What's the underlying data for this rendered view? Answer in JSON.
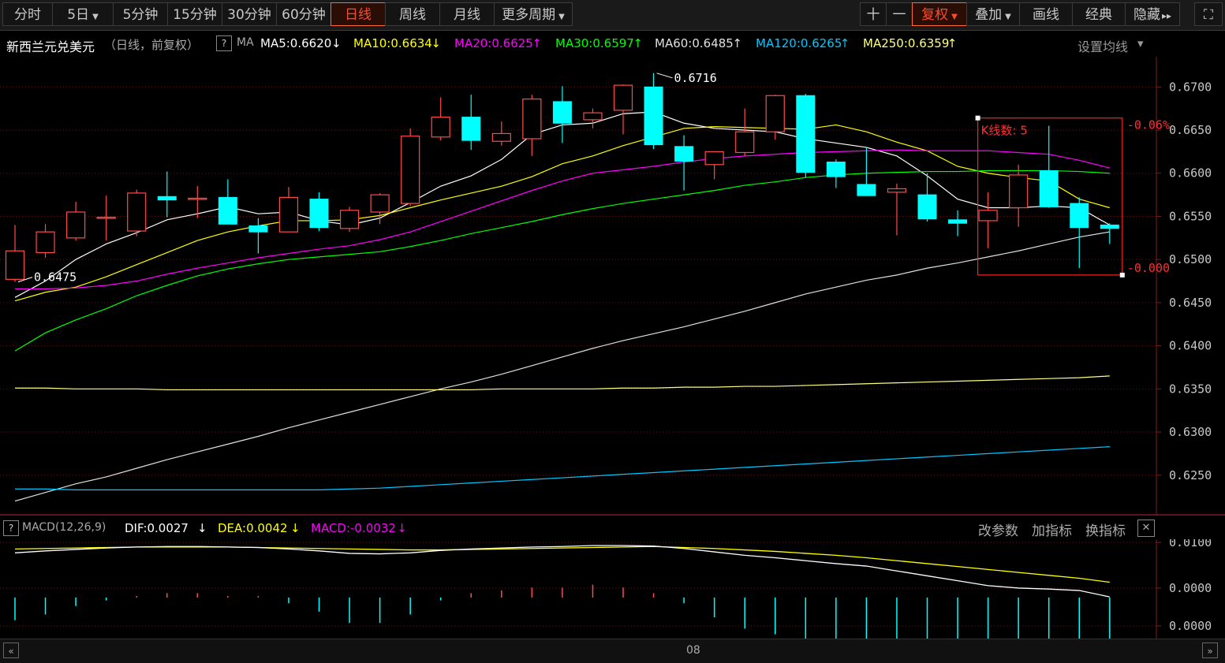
{
  "toolbar": {
    "periods": [
      {
        "label": "分时",
        "dropdown": false,
        "active": false
      },
      {
        "label": "5日",
        "dropdown": true,
        "active": false
      },
      {
        "label": "5分钟",
        "dropdown": false,
        "active": false
      },
      {
        "label": "15分钟",
        "dropdown": false,
        "active": false
      },
      {
        "label": "30分钟",
        "dropdown": false,
        "active": false
      },
      {
        "label": "60分钟",
        "dropdown": false,
        "active": false
      },
      {
        "label": "日线",
        "dropdown": false,
        "active": true
      },
      {
        "label": "周线",
        "dropdown": false,
        "active": false
      },
      {
        "label": "月线",
        "dropdown": false,
        "active": false
      },
      {
        "label": "更多周期",
        "dropdown": true,
        "active": false
      }
    ],
    "right_buttons": [
      {
        "label": "十",
        "dropdown": false,
        "active": false
      },
      {
        "label": "一",
        "dropdown": false,
        "active": false
      },
      {
        "label": "复权",
        "dropdown": true,
        "active": true
      },
      {
        "label": "叠加",
        "dropdown": true,
        "active": false
      },
      {
        "label": "画线",
        "dropdown": false,
        "active": false
      },
      {
        "label": "经典",
        "dropdown": false,
        "active": false
      },
      {
        "label": "隐藏",
        "dropdown": false,
        "active": false
      }
    ],
    "hide_arrow": "▸▸",
    "fullscreen_glyph": "⛶"
  },
  "legend": {
    "title": "新西兰元兑美元",
    "subtitle": "（日线，前复权）",
    "help": "?",
    "ma_label": "MA",
    "items": [
      {
        "text": "MA5:0.6620",
        "arrow": "↓",
        "color": "#ffffff"
      },
      {
        "text": "MA10:0.6634",
        "arrow": "↓",
        "color": "#ffff00"
      },
      {
        "text": "MA20:0.6625",
        "arrow": "↑",
        "color": "#ff00ff"
      },
      {
        "text": "MA30:0.6597",
        "arrow": "↑",
        "color": "#00ff00"
      },
      {
        "text": "MA60:0.6485",
        "arrow": "↑",
        "color": "#e0e0e0"
      },
      {
        "text": "MA120:0.6265",
        "arrow": "↑",
        "color": "#00c8ff"
      },
      {
        "text": "MA250:0.6359",
        "arrow": "↑",
        "color": "#ffff80"
      }
    ],
    "settings": "设置均线",
    "settings_caret": "▾"
  },
  "macd_header": {
    "help": "?",
    "name": "MACD(12,26,9)",
    "items": [
      {
        "text": "DIF:0.0027",
        "arrow": "↓",
        "color": "#ffffff"
      },
      {
        "text": "DEA:0.0042",
        "arrow": "↓",
        "color": "#ffff00"
      },
      {
        "text": "MACD:-0.0032",
        "arrow": "↓",
        "color": "#ff00ff"
      }
    ],
    "actions": [
      "改参数",
      "加指标",
      "换指标"
    ],
    "close": "✕"
  },
  "annotations": {
    "high_label": "0.6716",
    "low_label": "0.6475",
    "box_count": "K线数: 5",
    "box_top_pct": "-0.06%",
    "box_bottom_pct": "-0.000"
  },
  "x_axis_label": "08",
  "nav": {
    "left": "«",
    "right": "»"
  },
  "colors": {
    "up": "#ff4a4a",
    "down": "#00ffff",
    "grid": "#5a1a1a",
    "axis_text": "#c8c8c8",
    "ma5": "#ffffff",
    "ma10": "#ffff00",
    "ma20": "#ff00ff",
    "ma30": "#00ff00",
    "ma60": "#e0e0e0",
    "ma120": "#00c8ff",
    "ma250": "#ffff80"
  },
  "chart_data": [
    {
      "type": "candlestick",
      "ylim": [
        0.6205,
        0.6735
      ],
      "yticks": [
        0.625,
        0.63,
        0.635,
        0.64,
        0.645,
        0.65,
        0.655,
        0.66,
        0.665,
        0.67
      ],
      "candles": [
        {
          "o": 0.6477,
          "h": 0.654,
          "l": 0.6474,
          "c": 0.651
        },
        {
          "o": 0.6508,
          "h": 0.6541,
          "l": 0.6502,
          "c": 0.6532
        },
        {
          "o": 0.6525,
          "h": 0.6567,
          "l": 0.6522,
          "c": 0.6555
        },
        {
          "o": 0.6549,
          "h": 0.6574,
          "l": 0.6522,
          "c": 0.6549
        },
        {
          "o": 0.6533,
          "h": 0.6581,
          "l": 0.6527,
          "c": 0.6577
        },
        {
          "o": 0.6573,
          "h": 0.6602,
          "l": 0.6549,
          "c": 0.6569
        },
        {
          "o": 0.6571,
          "h": 0.6585,
          "l": 0.6548,
          "c": 0.6571
        },
        {
          "o": 0.6572,
          "h": 0.6593,
          "l": 0.6542,
          "c": 0.6541
        },
        {
          "o": 0.6539,
          "h": 0.6548,
          "l": 0.6507,
          "c": 0.6532
        },
        {
          "o": 0.6532,
          "h": 0.6584,
          "l": 0.6532,
          "c": 0.6572
        },
        {
          "o": 0.657,
          "h": 0.6578,
          "l": 0.6533,
          "c": 0.6537
        },
        {
          "o": 0.6536,
          "h": 0.6561,
          "l": 0.6532,
          "c": 0.6557
        },
        {
          "o": 0.6555,
          "h": 0.6577,
          "l": 0.6541,
          "c": 0.6575
        },
        {
          "o": 0.6565,
          "h": 0.6652,
          "l": 0.6562,
          "c": 0.6643
        },
        {
          "o": 0.6642,
          "h": 0.6688,
          "l": 0.6638,
          "c": 0.6665
        },
        {
          "o": 0.6665,
          "h": 0.6691,
          "l": 0.6627,
          "c": 0.6638
        },
        {
          "o": 0.6637,
          "h": 0.666,
          "l": 0.6632,
          "c": 0.6646
        },
        {
          "o": 0.664,
          "h": 0.6691,
          "l": 0.662,
          "c": 0.6686
        },
        {
          "o": 0.6683,
          "h": 0.6701,
          "l": 0.6635,
          "c": 0.6658
        },
        {
          "o": 0.6662,
          "h": 0.6675,
          "l": 0.6652,
          "c": 0.667
        },
        {
          "o": 0.6673,
          "h": 0.6703,
          "l": 0.6645,
          "c": 0.6702
        },
        {
          "o": 0.67,
          "h": 0.6716,
          "l": 0.6628,
          "c": 0.6633
        },
        {
          "o": 0.6631,
          "h": 0.6644,
          "l": 0.658,
          "c": 0.6614
        },
        {
          "o": 0.661,
          "h": 0.6625,
          "l": 0.6593,
          "c": 0.6625
        },
        {
          "o": 0.6624,
          "h": 0.6675,
          "l": 0.662,
          "c": 0.6648
        },
        {
          "o": 0.6648,
          "h": 0.6691,
          "l": 0.6639,
          "c": 0.669
        },
        {
          "o": 0.669,
          "h": 0.6692,
          "l": 0.6595,
          "c": 0.6601
        },
        {
          "o": 0.6613,
          "h": 0.6616,
          "l": 0.6583,
          "c": 0.6596
        },
        {
          "o": 0.6587,
          "h": 0.663,
          "l": 0.6575,
          "c": 0.6574
        },
        {
          "o": 0.6578,
          "h": 0.6588,
          "l": 0.6528,
          "c": 0.6582
        },
        {
          "o": 0.6575,
          "h": 0.66,
          "l": 0.6544,
          "c": 0.6547
        },
        {
          "o": 0.6546,
          "h": 0.6557,
          "l": 0.6527,
          "c": 0.6542
        },
        {
          "o": 0.6545,
          "h": 0.6578,
          "l": 0.6513,
          "c": 0.6557
        },
        {
          "o": 0.656,
          "h": 0.661,
          "l": 0.6538,
          "c": 0.6598
        },
        {
          "o": 0.6603,
          "h": 0.6655,
          "l": 0.656,
          "c": 0.6561
        },
        {
          "o": 0.6565,
          "h": 0.6572,
          "l": 0.649,
          "c": 0.6537
        },
        {
          "o": 0.654,
          "h": 0.6542,
          "l": 0.6518,
          "c": 0.6536
        }
      ],
      "ma": [
        {
          "name": "MA5",
          "color": "#ffffff",
          "values": [
            0.6456,
            0.6475,
            0.65,
            0.6518,
            0.6531,
            0.6546,
            0.6553,
            0.6561,
            0.6553,
            0.6555,
            0.6545,
            0.654,
            0.6548,
            0.6566,
            0.6585,
            0.6597,
            0.6616,
            0.6645,
            0.6656,
            0.6658,
            0.6669,
            0.6671,
            0.6658,
            0.6652,
            0.665,
            0.6648,
            0.664,
            0.6635,
            0.663,
            0.662,
            0.6597,
            0.657,
            0.656,
            0.656,
            0.6562,
            0.656,
            0.654
          ]
        },
        {
          "name": "MA10",
          "color": "#ffff00",
          "values": [
            0.6452,
            0.6462,
            0.6468,
            0.648,
            0.6494,
            0.6508,
            0.6522,
            0.6532,
            0.6539,
            0.6545,
            0.6545,
            0.6546,
            0.6551,
            0.656,
            0.6569,
            0.6577,
            0.6585,
            0.6596,
            0.6611,
            0.662,
            0.6632,
            0.6642,
            0.6652,
            0.6654,
            0.6653,
            0.6652,
            0.6651,
            0.6656,
            0.6648,
            0.6636,
            0.6626,
            0.6608,
            0.66,
            0.6595,
            0.6591,
            0.657,
            0.656
          ]
        },
        {
          "name": "MA20",
          "color": "#ff00ff",
          "values": [
            0.6466,
            0.6466,
            0.6467,
            0.647,
            0.6475,
            0.6483,
            0.649,
            0.6496,
            0.6502,
            0.6507,
            0.6512,
            0.6516,
            0.6523,
            0.6532,
            0.6544,
            0.6556,
            0.6568,
            0.658,
            0.6591,
            0.66,
            0.6604,
            0.6608,
            0.6613,
            0.6617,
            0.662,
            0.6622,
            0.6624,
            0.6625,
            0.6626,
            0.6627,
            0.6626,
            0.6626,
            0.6626,
            0.6624,
            0.6622,
            0.6615,
            0.6606
          ]
        },
        {
          "name": "MA30",
          "color": "#00ff00",
          "values": [
            0.6394,
            0.6415,
            0.643,
            0.6443,
            0.6458,
            0.647,
            0.6481,
            0.6489,
            0.6495,
            0.65,
            0.6503,
            0.6506,
            0.6509,
            0.6515,
            0.6522,
            0.653,
            0.6537,
            0.6544,
            0.6552,
            0.6559,
            0.6565,
            0.657,
            0.6575,
            0.658,
            0.6586,
            0.659,
            0.6595,
            0.6598,
            0.66,
            0.6601,
            0.6602,
            0.6602,
            0.6603,
            0.6603,
            0.6603,
            0.6602,
            0.66
          ]
        },
        {
          "name": "MA60",
          "color": "#e0e0e0",
          "values": [
            0.622,
            0.623,
            0.624,
            0.6248,
            0.6258,
            0.6268,
            0.6277,
            0.6286,
            0.6295,
            0.6305,
            0.6314,
            0.6323,
            0.6332,
            0.6341,
            0.635,
            0.6358,
            0.6367,
            0.6377,
            0.6387,
            0.6397,
            0.6406,
            0.6414,
            0.6422,
            0.6431,
            0.644,
            0.645,
            0.646,
            0.6468,
            0.6476,
            0.6482,
            0.649,
            0.6496,
            0.6503,
            0.651,
            0.6518,
            0.6526,
            0.6532
          ]
        },
        {
          "name": "MA120",
          "color": "#00c8ff",
          "values": [
            0.6234,
            0.6234,
            0.6233,
            0.6233,
            0.6233,
            0.6233,
            0.6233,
            0.6233,
            0.6233,
            0.6233,
            0.6233,
            0.6234,
            0.6235,
            0.6237,
            0.6239,
            0.6241,
            0.6243,
            0.6245,
            0.6247,
            0.6249,
            0.6251,
            0.6253,
            0.6255,
            0.6257,
            0.6259,
            0.6261,
            0.6263,
            0.6265,
            0.6267,
            0.6269,
            0.6271,
            0.6273,
            0.6275,
            0.6277,
            0.6279,
            0.6281,
            0.6283
          ]
        },
        {
          "name": "MA250",
          "color": "#ffff80",
          "values": [
            0.6351,
            0.6351,
            0.635,
            0.635,
            0.635,
            0.6349,
            0.6349,
            0.6349,
            0.6349,
            0.6349,
            0.6349,
            0.6349,
            0.6349,
            0.6349,
            0.6349,
            0.6349,
            0.635,
            0.635,
            0.635,
            0.635,
            0.6351,
            0.6351,
            0.6352,
            0.6352,
            0.6353,
            0.6353,
            0.6354,
            0.6355,
            0.6356,
            0.6357,
            0.6358,
            0.6359,
            0.636,
            0.6361,
            0.6362,
            0.6363,
            0.6365
          ]
        }
      ]
    },
    {
      "type": "macd",
      "ylim": [
        -0.001,
        0.0012
      ],
      "yticks": [
        0.01,
        0.0,
        -0.0
      ],
      "dif": [
        0.0082,
        0.0086,
        0.0089,
        0.0092,
        0.0094,
        0.0095,
        0.0095,
        0.0094,
        0.0093,
        0.009,
        0.0086,
        0.0081,
        0.008,
        0.0082,
        0.0087,
        0.009,
        0.0092,
        0.0094,
        0.0095,
        0.0097,
        0.0097,
        0.0096,
        0.0091,
        0.0084,
        0.0077,
        0.0072,
        0.0066,
        0.006,
        0.0055,
        0.0045,
        0.0035,
        0.0025,
        0.0015,
        0.001,
        0.0008,
        0.0005,
        -0.0008
      ],
      "dea": [
        0.009,
        0.0091,
        0.0092,
        0.0093,
        0.0094,
        0.0094,
        0.0094,
        0.0094,
        0.0093,
        0.0092,
        0.0091,
        0.009,
        0.0089,
        0.0088,
        0.0088,
        0.0089,
        0.009,
        0.0091,
        0.0092,
        0.0093,
        0.0094,
        0.0095,
        0.0093,
        0.0091,
        0.0088,
        0.0085,
        0.0081,
        0.0077,
        0.0072,
        0.0066,
        0.006,
        0.0054,
        0.0048,
        0.0042,
        0.0036,
        0.003,
        0.0022
      ],
      "hist": [
        -0.0016,
        -0.0012,
        -0.0006,
        -0.0002,
        0.0,
        0.0002,
        0.0002,
        0.0,
        0.0,
        -0.0004,
        -0.001,
        -0.0018,
        -0.0018,
        -0.0012,
        -0.0002,
        0.0002,
        0.0004,
        0.0006,
        0.0006,
        0.0008,
        0.0006,
        0.0002,
        -0.0004,
        -0.0014,
        -0.0022,
        -0.0026,
        -0.003,
        -0.0034,
        -0.0034,
        -0.0042,
        -0.005,
        -0.0058,
        -0.0066,
        -0.0064,
        -0.0056,
        -0.005,
        -0.006
      ]
    }
  ]
}
